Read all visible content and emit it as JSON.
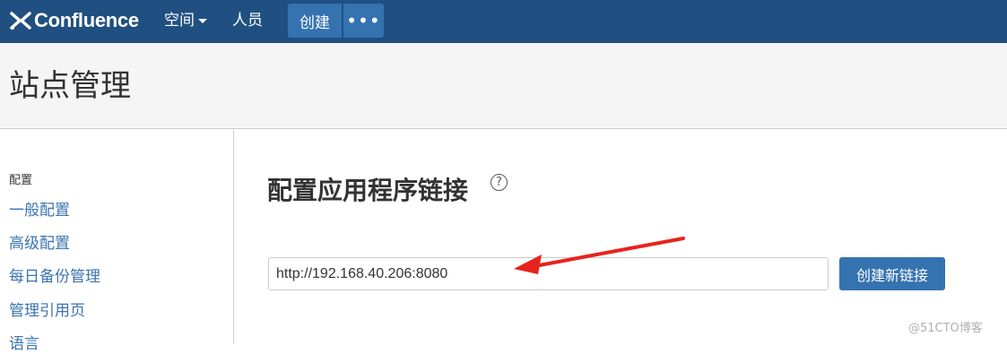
{
  "topbar": {
    "logo_text": "Confluence",
    "nav_spaces": "空间",
    "nav_people": "人员",
    "create_button": "创建",
    "more_button": "•••"
  },
  "header": {
    "title": "站点管理"
  },
  "sidebar": {
    "heading": "配置",
    "items": [
      {
        "label": "一般配置"
      },
      {
        "label": "高级配置"
      },
      {
        "label": "每日备份管理"
      },
      {
        "label": "管理引用页"
      },
      {
        "label": "语言"
      }
    ]
  },
  "main": {
    "title": "配置应用程序链接",
    "help_symbol": "?",
    "url_input_value": "http://192.168.40.206:8080",
    "create_link_button": "创建新链接"
  },
  "annotation": {
    "arrow_color": "#e8231e"
  },
  "watermark": "@51CTO博客",
  "colors": {
    "topbar_bg": "#205081",
    "button_bg": "#3572b0",
    "link": "#3b73af"
  }
}
